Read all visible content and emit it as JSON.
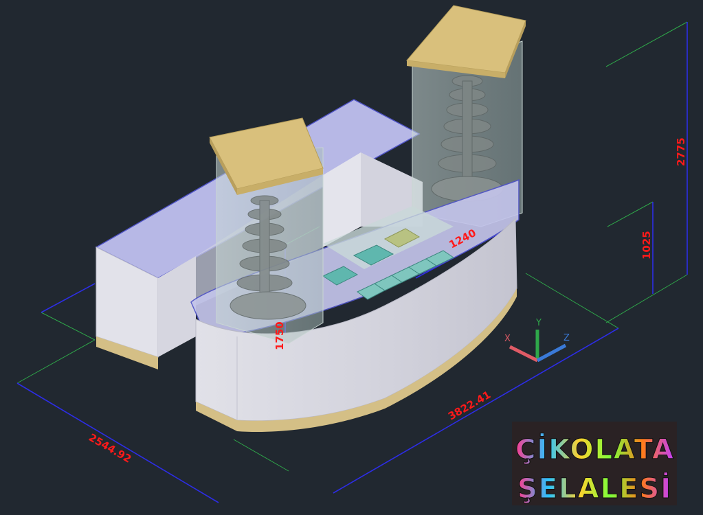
{
  "drawing": {
    "dimensions": {
      "total_height": "2775",
      "counter_height": "1025",
      "front_height": "1750",
      "depth": "2544.92",
      "width": "3822.41",
      "glass_width": "1240"
    },
    "axes": {
      "x": "X",
      "y": "Y",
      "z": "Z"
    },
    "logo": {
      "line1": "ÇİKOLATA",
      "line2": "ŞELALESİ"
    }
  },
  "colors": {
    "background": "#212830",
    "dimension_text": "#ff1a1a",
    "dimension_line": "#2d2de6",
    "extension_line": "#2fa84a",
    "counter_body": "#d9d9e3",
    "counter_top": "#b7b8e6",
    "base_plinth": "#d4bf86",
    "tower_roof": "#d9c07c",
    "glass": "#b9cbc7",
    "fountain": "#7f8786"
  }
}
